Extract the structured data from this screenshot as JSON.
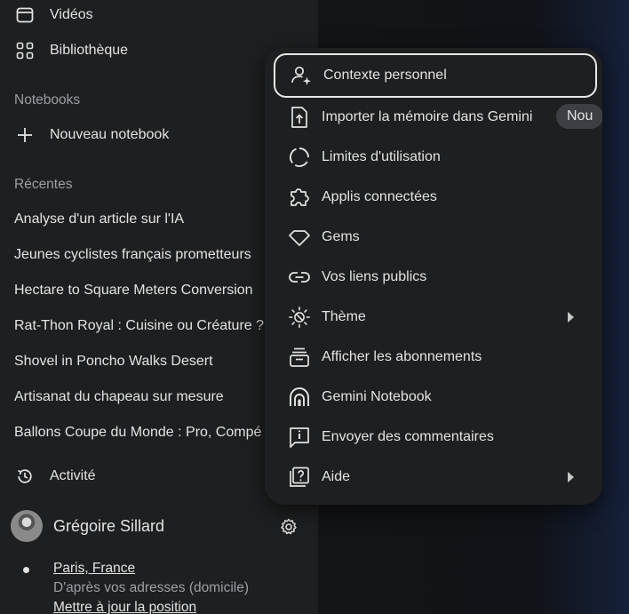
{
  "sidebar": {
    "nav": [
      {
        "label": "Vidéos",
        "icon": "video-icon"
      },
      {
        "label": "Bibliothèque",
        "icon": "library-icon"
      }
    ],
    "notebooks_title": "Notebooks",
    "new_notebook": "Nouveau notebook",
    "recent_title": "Récentes",
    "recent": [
      "Analyse d'un article sur l'IA",
      "Jeunes cyclistes français prometteurs",
      "Hectare to Square Meters Conversion",
      "Rat-Thon Royal : Cuisine ou Créature ?",
      "Shovel in Poncho Walks Desert",
      "Artisanat du chapeau sur mesure",
      "Ballons Coupe du Monde : Pro, Compé"
    ],
    "activity": "Activité",
    "user_name": "Grégoire Sillard",
    "location": "Paris, France",
    "location_source": "D'après vos adresses (domicile)",
    "update_location": "Mettre à jour la position"
  },
  "menu": {
    "items": [
      {
        "label": "Contexte personnel",
        "icon": "personal-context-icon"
      },
      {
        "label": "Importer la mémoire dans Gemini",
        "icon": "import-icon",
        "badge": "Nou"
      },
      {
        "label": "Limites d'utilisation",
        "icon": "usage-limits-icon"
      },
      {
        "label": "Applis connectées",
        "icon": "puzzle-icon"
      },
      {
        "label": "Gems",
        "icon": "gem-icon"
      },
      {
        "label": "Vos liens publics",
        "icon": "link-icon"
      },
      {
        "label": "Thème",
        "icon": "theme-icon"
      },
      {
        "label": "Afficher les abonnements",
        "icon": "subscriptions-icon"
      },
      {
        "label": "Gemini Notebook",
        "icon": "notebook-icon"
      },
      {
        "label": "Envoyer des commentaires",
        "icon": "feedback-icon"
      },
      {
        "label": "Aide",
        "icon": "help-icon"
      }
    ]
  }
}
